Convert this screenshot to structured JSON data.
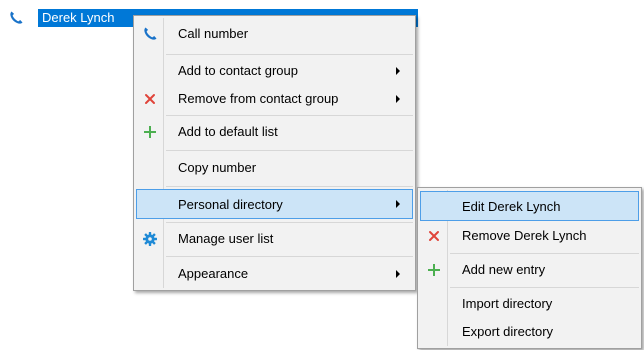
{
  "contact": {
    "name": "Derek Lynch",
    "icon": "phone-icon"
  },
  "context_menu": {
    "items": [
      {
        "label": "Call number",
        "icon": "phone-icon"
      },
      {
        "label": "Add to contact group",
        "submenu": true
      },
      {
        "label": "Remove from contact group",
        "icon": "red-x-icon",
        "submenu": true
      },
      {
        "label": "Add to default list",
        "icon": "green-plus-icon"
      },
      {
        "label": "Copy number"
      },
      {
        "label": "Personal directory",
        "submenu": true,
        "highlighted": true
      },
      {
        "label": "Manage user list",
        "icon": "gear-icon"
      },
      {
        "label": "Appearance",
        "submenu": true
      }
    ]
  },
  "submenu": {
    "items": [
      {
        "label": "Edit Derek Lynch",
        "highlighted": true
      },
      {
        "label": "Remove Derek Lynch",
        "icon": "red-x-icon"
      },
      {
        "label": "Add new entry",
        "icon": "green-plus-icon"
      },
      {
        "label": "Import directory"
      },
      {
        "label": "Export directory"
      }
    ]
  },
  "colors": {
    "selection": "#0078d7",
    "highlight": "#cce4f7",
    "highlight_border": "#4d9ee8",
    "phone_icon": "#1a73c9",
    "remove_icon": "#e0443a",
    "add_icon": "#4caf50",
    "gear_icon": "#1f8ad6"
  }
}
